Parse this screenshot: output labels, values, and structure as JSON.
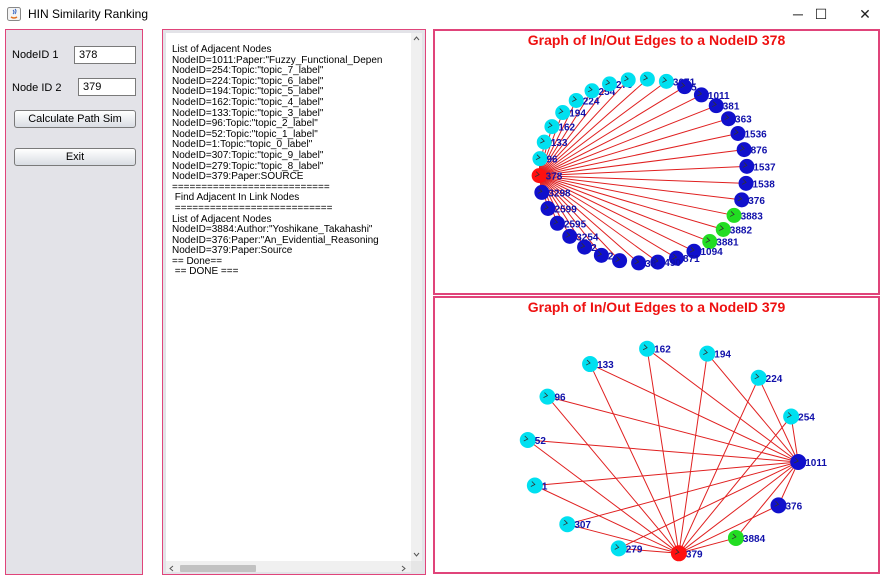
{
  "window": {
    "title": "HIN Similarity Ranking",
    "controls": [
      "─",
      "☐",
      "✕"
    ]
  },
  "form": {
    "node1_label": "NodeID 1",
    "node1_value": "378",
    "node2_label": "Node ID 2",
    "node2_value": "379",
    "calc_button": "Calculate Path Sim",
    "exit_button": "Exit"
  },
  "output_lines": [
    "List of Adjacent Nodes",
    "NodeID=1011:Paper:\"Fuzzy_Functional_Depen",
    "NodeID=254:Topic:\"topic_7_label\"",
    "NodeID=224:Topic:\"topic_6_label\"",
    "NodeID=194:Topic:\"topic_5_label\"",
    "NodeID=162:Topic:\"topic_4_label\"",
    "NodeID=133:Topic:\"topic_3_label\"",
    "NodeID=96:Topic:\"topic_2_label\"",
    "NodeID=52:Topic:\"topic_1_label\"",
    "NodeID=1:Topic:\"topic_0_label\"",
    "NodeID=307:Topic:\"topic_9_label\"",
    "NodeID=279:Topic:\"topic_8_label\"",
    "NodeID=379:Paper:SOURCE",
    "===========================",
    " Find Adjacent In Link Nodes",
    " ===========================",
    "List of Adjacent Nodes",
    "NodeID=3884:Author:\"Yoshikane_Takahashi\"",
    "NodeID=376:Paper:\"An_Evidential_Reasoning",
    "NodeID=379:Paper:Source",
    "== Done==",
    " == DONE ==="
  ],
  "graph1": {
    "title": "Graph of In/Out Edges to a NodeID 378",
    "center_label": "378",
    "nodes": [
      {
        "label": "3071",
        "color": "#00e0f0"
      },
      {
        "label": "5",
        "color": "#1010cc"
      },
      {
        "label": "1011",
        "color": "#1010cc"
      },
      {
        "label": "381",
        "color": "#1010cc"
      },
      {
        "label": "363",
        "color": "#1010cc"
      },
      {
        "label": "1536",
        "color": "#1010cc"
      },
      {
        "label": "876",
        "color": "#1010cc"
      },
      {
        "label": "1537",
        "color": "#1010cc"
      },
      {
        "label": "1538",
        "color": "#1010cc"
      },
      {
        "label": "376",
        "color": "#1010cc"
      },
      {
        "label": "3883",
        "color": "#22dd22"
      },
      {
        "label": "3882",
        "color": "#22dd22"
      },
      {
        "label": "3881",
        "color": "#22dd22"
      },
      {
        "label": "1094",
        "color": "#1010cc"
      },
      {
        "label": "871",
        "color": "#1010cc"
      },
      {
        "label": "490",
        "color": "#1010cc"
      },
      {
        "label": "38",
        "color": "#1010cc"
      },
      {
        "label": "",
        "color": "#1010cc"
      },
      {
        "label": "2",
        "color": "#1010cc"
      },
      {
        "label": "2",
        "color": "#1010cc"
      },
      {
        "label": "3254",
        "color": "#1010cc"
      },
      {
        "label": "2595",
        "color": "#1010cc"
      },
      {
        "label": "2599",
        "color": "#1010cc"
      },
      {
        "label": "3298",
        "color": "#1010cc"
      },
      {
        "label": "378",
        "color": "#ff1010"
      },
      {
        "label": "96",
        "color": "#00e0f0"
      },
      {
        "label": "133",
        "color": "#00e0f0"
      },
      {
        "label": "162",
        "color": "#00e0f0"
      },
      {
        "label": "194",
        "color": "#00e0f0"
      },
      {
        "label": "224",
        "color": "#00e0f0"
      },
      {
        "label": "254",
        "color": "#00e0f0"
      },
      {
        "label": "279",
        "color": "#00e0f0"
      },
      {
        "label": "",
        "color": "#00e0f0"
      },
      {
        "label": "",
        "color": "#00e0f0"
      }
    ]
  },
  "graph2": {
    "title": "Graph of In/Out Edges to a NodeID 379",
    "center_label": "379",
    "hub_label": "1011",
    "nodes": [
      {
        "label": "194",
        "color": "#00e0f0"
      },
      {
        "label": "224",
        "color": "#00e0f0"
      },
      {
        "label": "254",
        "color": "#00e0f0"
      },
      {
        "label": "1011",
        "color": "#1010cc"
      },
      {
        "label": "376",
        "color": "#1010cc"
      },
      {
        "label": "3884",
        "color": "#22dd22"
      },
      {
        "label": "379",
        "color": "#ff1010"
      },
      {
        "label": "279",
        "color": "#00e0f0"
      },
      {
        "label": "307",
        "color": "#00e0f0"
      },
      {
        "label": "1",
        "color": "#00e0f0"
      },
      {
        "label": "52",
        "color": "#00e0f0"
      },
      {
        "label": "96",
        "color": "#00e0f0"
      },
      {
        "label": "133",
        "color": "#00e0f0"
      },
      {
        "label": "162",
        "color": "#00e0f0"
      }
    ]
  }
}
